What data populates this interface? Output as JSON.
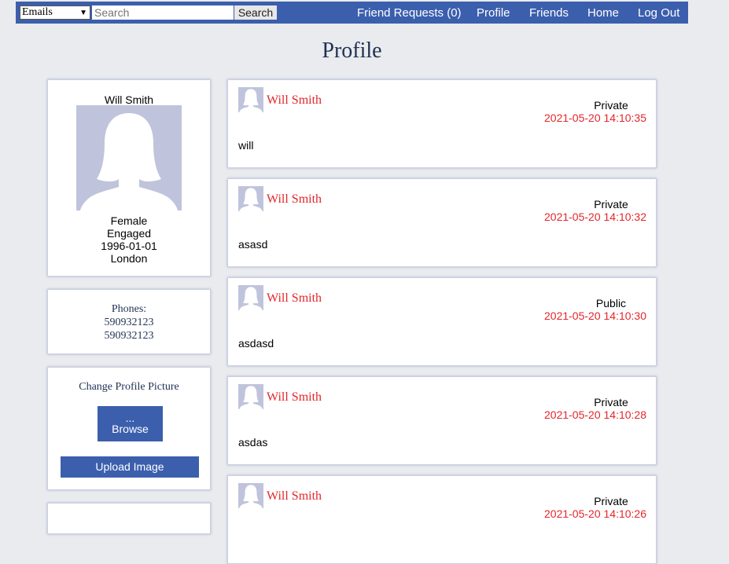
{
  "nav": {
    "search_type": "Emails",
    "search_placeholder": "Search",
    "search_button": "Search",
    "links": [
      "Friend Requests (0)",
      "Profile",
      "Friends",
      "Home",
      "Log Out"
    ]
  },
  "page_title": "Profile",
  "user": {
    "name": "Will Smith",
    "gender": "Female",
    "relationship": "Engaged",
    "birthdate": "1996-01-01",
    "city": "London"
  },
  "phones": {
    "label": "Phones:",
    "numbers": [
      "590932123",
      "590932123"
    ]
  },
  "upload": {
    "title": "Change Profile Picture",
    "browse_dots": "...",
    "browse_label": "Browse",
    "upload_label": "Upload Image"
  },
  "posts": [
    {
      "author": "Will Smith",
      "privacy": "Private",
      "date": "2021-05-20 14:10:35",
      "text": "will"
    },
    {
      "author": "Will Smith",
      "privacy": "Private",
      "date": "2021-05-20 14:10:32",
      "text": "asasd"
    },
    {
      "author": "Will Smith",
      "privacy": "Public",
      "date": "2021-05-20 14:10:30",
      "text": "asdasd"
    },
    {
      "author": "Will Smith",
      "privacy": "Private",
      "date": "2021-05-20 14:10:28",
      "text": "asdas"
    },
    {
      "author": "Will Smith",
      "privacy": "Private",
      "date": "2021-05-20 14:10:26",
      "text": ""
    }
  ],
  "colors": {
    "nav_bg": "#3b5fad",
    "page_bg": "#e9ebee",
    "accent_red": "#e3262b",
    "title_navy": "#1f3152",
    "avatar_placeholder": "#bfc4dc"
  }
}
